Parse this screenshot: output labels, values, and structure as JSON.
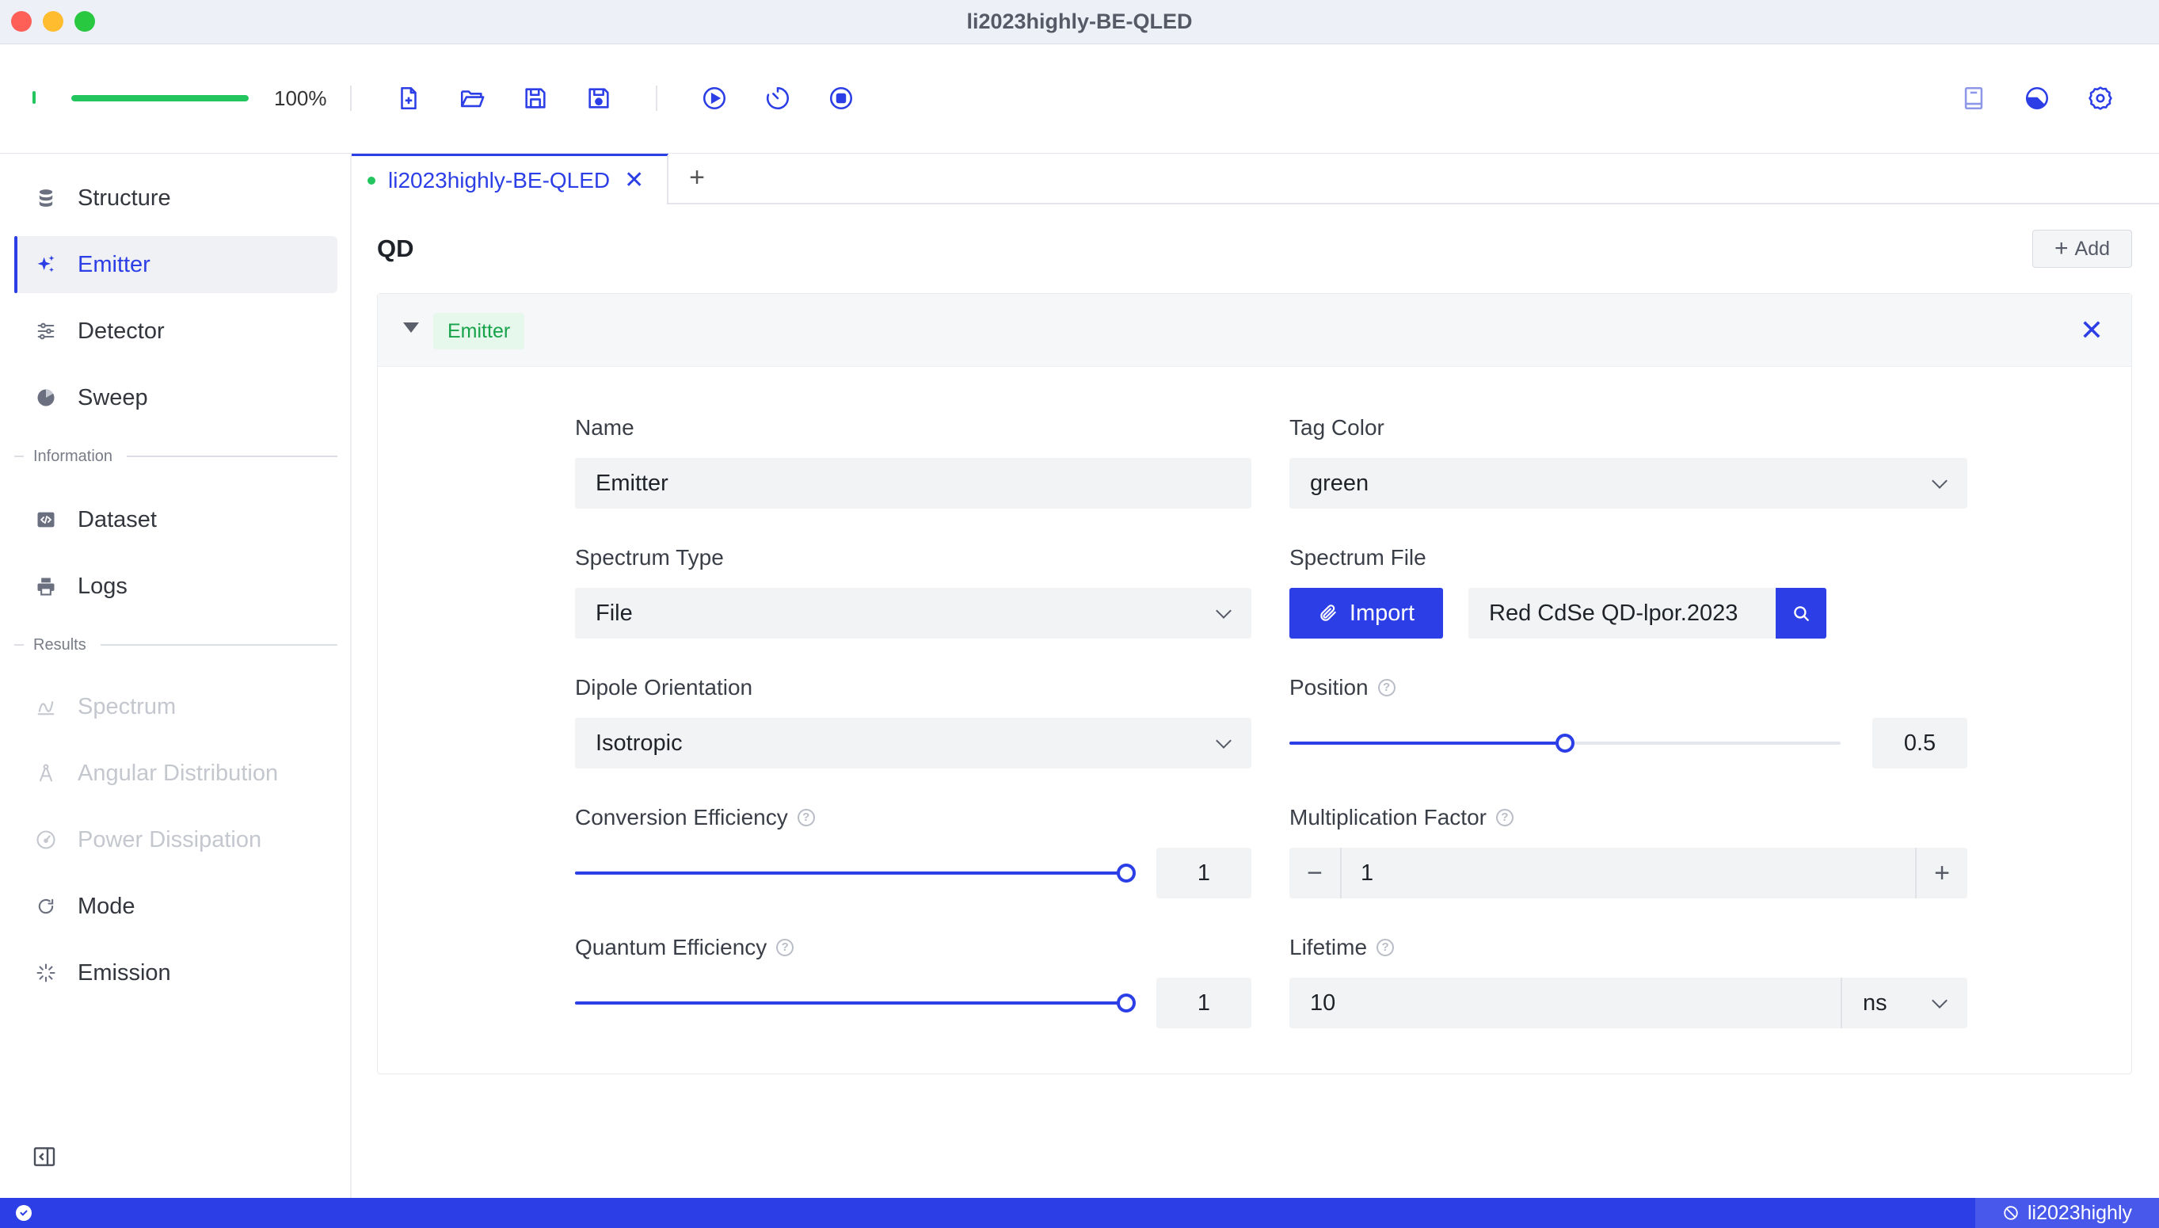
{
  "window": {
    "title": "li2023highly-BE-QLED"
  },
  "toolbar": {
    "progress_value": 1.0,
    "progress_text": "100%",
    "accent": "#2c3ee6",
    "progress_color": "#22c55e",
    "left_icons": [
      "new-file-icon",
      "open-folder-icon",
      "save-icon",
      "save-as-icon"
    ],
    "run_icons": [
      "play-icon",
      "timer-icon",
      "stop-icon"
    ],
    "right_icons": [
      "book-icon",
      "theme-icon",
      "settings-icon"
    ]
  },
  "sidebar": {
    "items": [
      {
        "label": "Structure",
        "icon": "database-icon"
      },
      {
        "label": "Emitter",
        "icon": "sparkles-icon",
        "active": true
      },
      {
        "label": "Detector",
        "icon": "sliders-icon"
      },
      {
        "label": "Sweep",
        "icon": "pie-icon"
      }
    ],
    "group_information": "Information",
    "info_items": [
      {
        "label": "Dataset",
        "icon": "code-icon"
      },
      {
        "label": "Logs",
        "icon": "printer-icon"
      }
    ],
    "group_results": "Results",
    "result_items": [
      {
        "label": "Spectrum",
        "icon": "spectrum-icon",
        "disabled": true
      },
      {
        "label": "Angular Distribution",
        "icon": "compass-icon",
        "disabled": true
      },
      {
        "label": "Power Dissipation",
        "icon": "gauge-icon",
        "disabled": true
      },
      {
        "label": "Mode",
        "icon": "mode-icon"
      },
      {
        "label": "Emission",
        "icon": "loader-icon"
      }
    ]
  },
  "tabs": [
    {
      "label": "li2023highly-BE-QLED"
    }
  ],
  "tab_add": "+",
  "main": {
    "section_title": "QD",
    "add_label": "Add",
    "panel": {
      "tag": "Emitter",
      "fields": {
        "name": {
          "label": "Name",
          "value": "Emitter"
        },
        "tag_color": {
          "label": "Tag Color",
          "value": "green"
        },
        "spectrum_type": {
          "label": "Spectrum Type",
          "value": "File"
        },
        "spectrum_file": {
          "label": "Spectrum File",
          "import_label": "Import",
          "value": "Red CdSe QD-lpor.2023"
        },
        "dipole_orientation": {
          "label": "Dipole Orientation",
          "value": "Isotropic"
        },
        "position": {
          "label": "Position",
          "value": "0.5",
          "fraction": 0.5
        },
        "conversion_efficiency": {
          "label": "Conversion Efficiency",
          "value": "1",
          "fraction": 1.0
        },
        "multiplication_factor": {
          "label": "Multiplication Factor",
          "value": "1",
          "minus": "−",
          "plus": "+"
        },
        "quantum_efficiency": {
          "label": "Quantum Efficiency",
          "value": "1",
          "fraction": 1.0
        },
        "lifetime": {
          "label": "Lifetime",
          "value": "10",
          "unit": "ns"
        }
      }
    }
  },
  "statusbar": {
    "right_label": "li2023highly"
  }
}
